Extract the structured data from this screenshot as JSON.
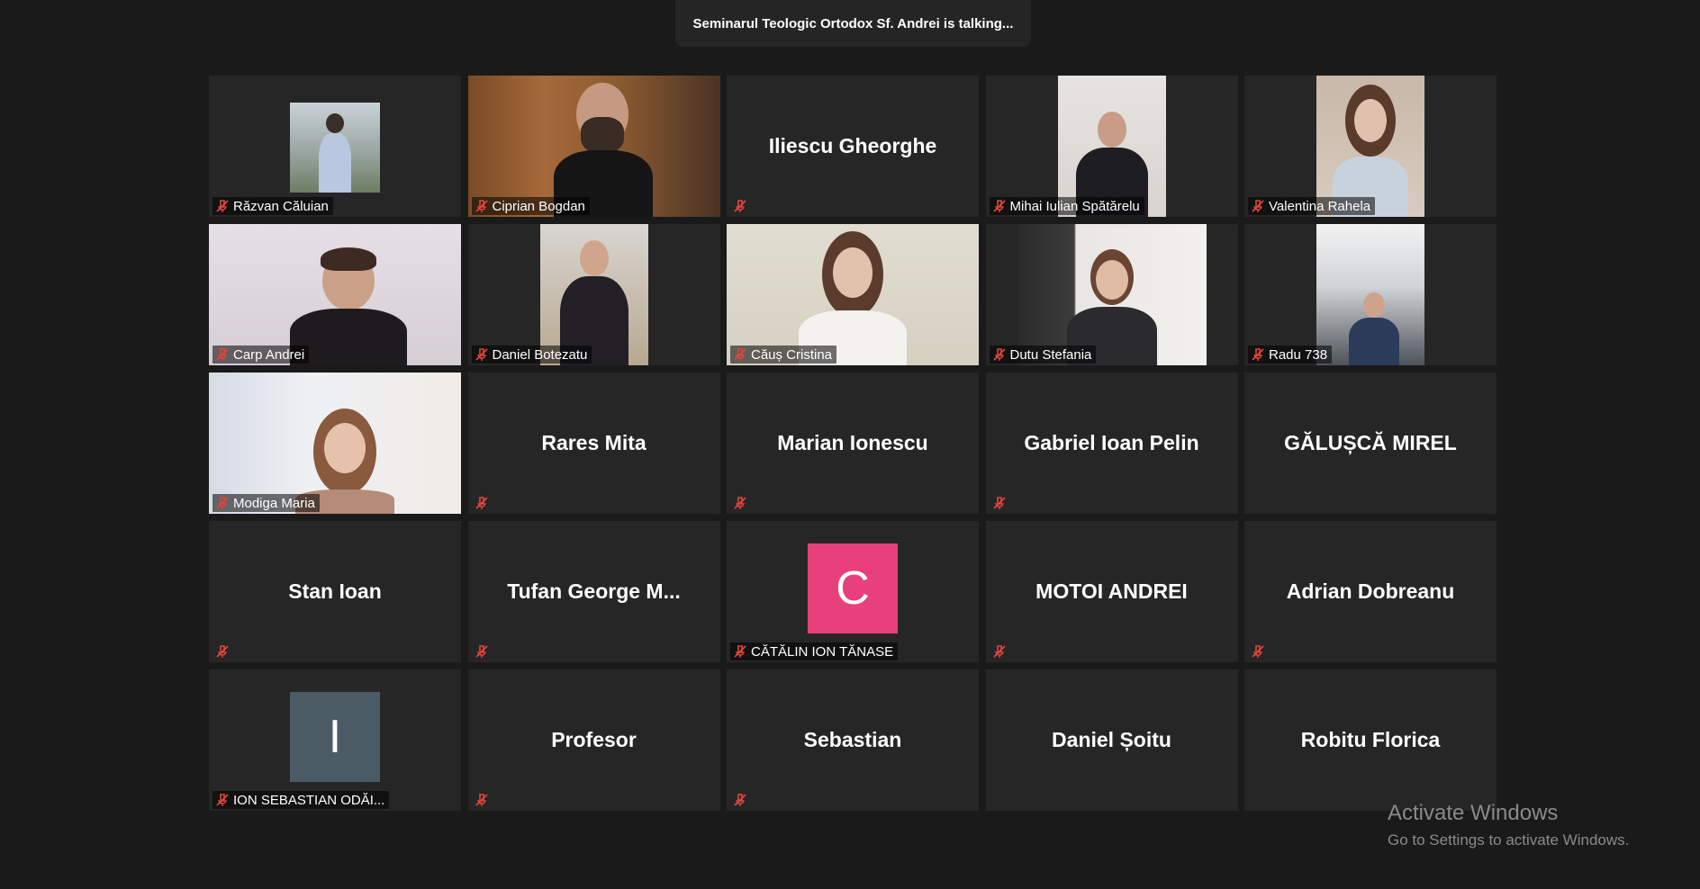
{
  "meeting": {
    "talking_banner": "Seminarul Teologic Ortodox Sf. Andrei is talking..."
  },
  "colors": {
    "background": "#1a1a1a",
    "tile": "#262626",
    "mute_icon": "#e1463c",
    "avatar_c": "#e8407a",
    "avatar_i": "#4a5b66"
  },
  "participants": [
    {
      "label": "Răzvan Căluian",
      "mode": "video"
    },
    {
      "label": "Ciprian Bogdan",
      "mode": "video"
    },
    {
      "label": "Iliescu Gheorghe",
      "mode": "name"
    },
    {
      "label": "Mihai Iulian Spătărelu",
      "mode": "video"
    },
    {
      "label": "Valentina Rahela",
      "mode": "video"
    },
    {
      "label": "Carp Andrei",
      "mode": "video"
    },
    {
      "label": "Daniel Botezatu",
      "mode": "video"
    },
    {
      "label": "Căuș Cristina",
      "mode": "video"
    },
    {
      "label": "Dutu Stefania",
      "mode": "video"
    },
    {
      "label": "Radu 738",
      "mode": "video"
    },
    {
      "label": "Modiga Maria",
      "mode": "video"
    },
    {
      "label": "Rares Mita",
      "mode": "name"
    },
    {
      "label": "Marian Ionescu",
      "mode": "name"
    },
    {
      "label": "Gabriel Ioan Pelin",
      "mode": "name"
    },
    {
      "label": "GĂLUȘCĂ MIREL",
      "mode": "name"
    },
    {
      "label": "Stan Ioan",
      "mode": "name"
    },
    {
      "label": "Tufan George M...",
      "mode": "name"
    },
    {
      "label": "CĂTĂLIN ION TĂNASE",
      "mode": "avatar",
      "avatar_letter": "C"
    },
    {
      "label": "MOTOI ANDREI",
      "mode": "name"
    },
    {
      "label": "Adrian Dobreanu",
      "mode": "name"
    },
    {
      "label": "ION SEBASTIAN ODĂI...",
      "mode": "avatar",
      "avatar_letter": "I"
    },
    {
      "label": "Profesor",
      "mode": "name"
    },
    {
      "label": "Sebastian",
      "mode": "name"
    },
    {
      "label": "Daniel Șoitu",
      "mode": "name"
    },
    {
      "label": "Robitu Florica",
      "mode": "name"
    }
  ],
  "watermark": {
    "title": "Activate Windows",
    "subtitle": "Go to Settings to activate Windows."
  }
}
